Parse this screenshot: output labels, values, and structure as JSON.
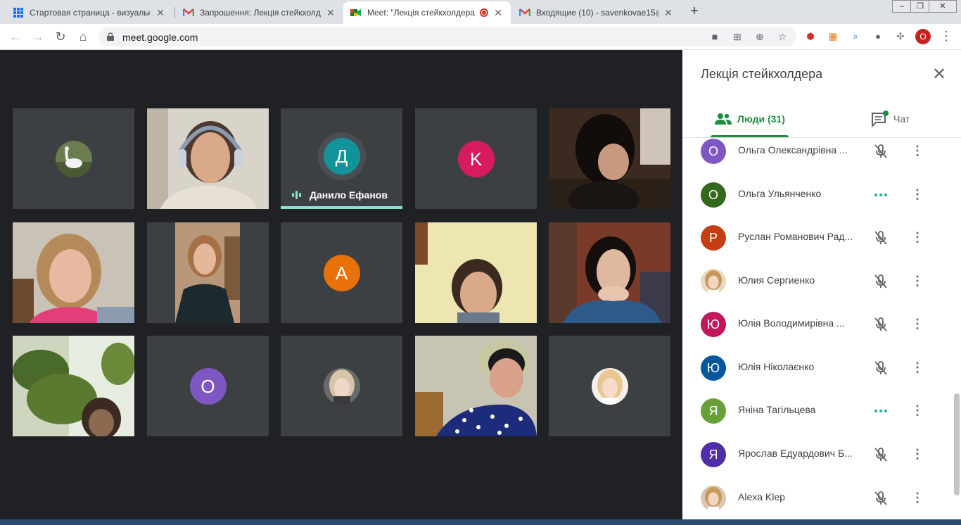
{
  "browser": {
    "tabs": [
      {
        "title": "Стартовая страница - визуальн",
        "icon": "grid-icon"
      },
      {
        "title": "Запрошення: Лекція стейкхолде",
        "icon": "gmail-icon"
      },
      {
        "title": "Meet: \"Лекція стейкхолдера",
        "icon": "meet-icon",
        "active": true
      },
      {
        "title": "Входящие (10) - savenkovae15@",
        "icon": "gmail-icon"
      }
    ],
    "url": "meet.google.com",
    "profile_initial": "О"
  },
  "meeting": {
    "tiles": [
      {
        "type": "photo-avatar",
        "name": "",
        "photo": "goose"
      },
      {
        "type": "video",
        "name": "",
        "photo": "woman-headphones"
      },
      {
        "type": "avatar",
        "initial": "Д",
        "color": "#12939a",
        "name": "Данило Ефанов",
        "speaking": true
      },
      {
        "type": "avatar",
        "initial": "K",
        "color": "#d81b60",
        "name": ""
      },
      {
        "type": "video",
        "name": "",
        "photo": "woman-dark-hair"
      },
      {
        "type": "video",
        "name": "",
        "photo": "woman-blonde-smile"
      },
      {
        "type": "video",
        "name": "",
        "photo": "woman-black-top"
      },
      {
        "type": "avatar",
        "initial": "A",
        "color": "#e8710a",
        "name": ""
      },
      {
        "type": "video",
        "name": "",
        "photo": "woman-yellow-wall"
      },
      {
        "type": "video",
        "name": "",
        "photo": "woman-hands-face"
      },
      {
        "type": "video",
        "name": "",
        "photo": "plants-window"
      },
      {
        "type": "avatar",
        "initial": "O",
        "color": "#7e57c2",
        "name": ""
      },
      {
        "type": "photo-avatar",
        "name": "",
        "photo": "girl-blonde"
      },
      {
        "type": "video",
        "name": "",
        "photo": "woman-polka-dots"
      },
      {
        "type": "photo-avatar",
        "name": "",
        "photo": "girl-blonde-2"
      }
    ]
  },
  "panel": {
    "title": "Лекція стейкхолдера",
    "people_tab": "Люди (31)",
    "chat_tab": "Чат",
    "participants": [
      {
        "name": "Ольга Олександрівна ...",
        "initial": "О",
        "color": "#7e57c2",
        "status": "muted"
      },
      {
        "name": "Ольга Ульянченко",
        "initial": "О",
        "color": "#33691e",
        "status": "speaking"
      },
      {
        "name": "Руслан Романович Рад...",
        "initial": "Р",
        "color": "#c53e13",
        "status": "muted"
      },
      {
        "name": "Юлия Сергиенко",
        "initial": "",
        "color": "#e9d8c4",
        "status": "muted",
        "photo": true
      },
      {
        "name": "Юлія Володимирівна ...",
        "initial": "Ю",
        "color": "#c2185b",
        "status": "muted"
      },
      {
        "name": "Юлія Ніколаєнко",
        "initial": "Ю",
        "color": "#01579b",
        "status": "muted"
      },
      {
        "name": "Яніна Тагільцева",
        "initial": "Я",
        "color": "#689f38",
        "status": "speaking"
      },
      {
        "name": "Ярослав Едуардович Б...",
        "initial": "Я",
        "color": "#512da8",
        "status": "muted"
      },
      {
        "name": "Alexa Klep",
        "initial": "",
        "color": "#d8c6b6",
        "status": "muted",
        "photo": true
      }
    ]
  },
  "colors": {
    "accent": "#1e8e3e",
    "speaking": "#8ae4d6",
    "background": "#202124",
    "tile": "#3c4043"
  }
}
